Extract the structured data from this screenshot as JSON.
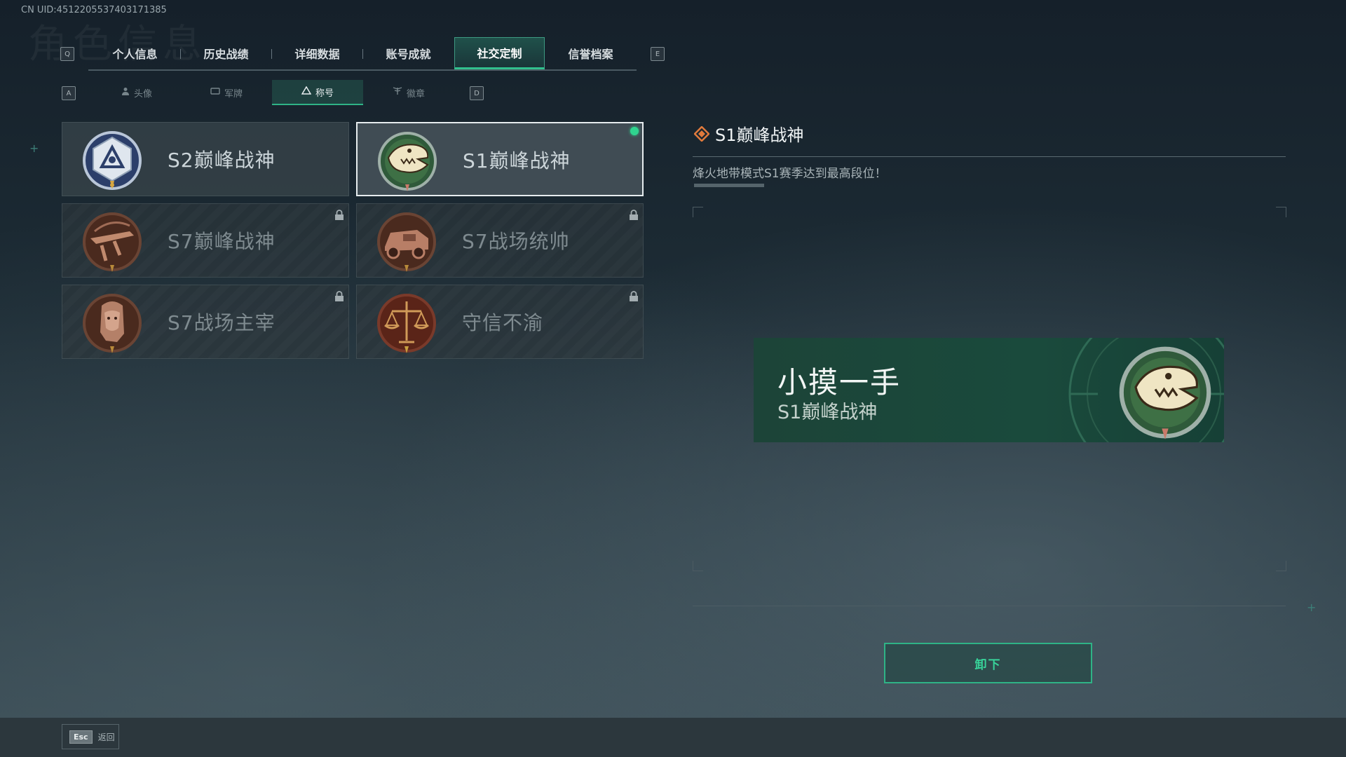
{
  "uid": "CN UID:4512205537403171385",
  "watermark": "角色信息",
  "main_tabs": {
    "left_key": "Q",
    "right_key": "E",
    "items": [
      "个人信息",
      "历史战绩",
      "详细数据",
      "账号成就",
      "社交定制",
      "信誉档案"
    ],
    "active_index": 4
  },
  "sub_tabs": {
    "left_key": "A",
    "right_key": "D",
    "items": [
      "头像",
      "军牌",
      "称号",
      "徽章"
    ],
    "active_index": 2
  },
  "titles": [
    {
      "label": "S2巅峰战神",
      "locked": false,
      "selected": false,
      "emblem": "silver-shield-emblem"
    },
    {
      "label": "S1巅峰战神",
      "locked": false,
      "selected": true,
      "emblem": "crocodile-emblem"
    },
    {
      "label": "S7巅峰战神",
      "locked": true,
      "selected": false,
      "emblem": "crossbow-emblem"
    },
    {
      "label": "S7战场统帅",
      "locked": true,
      "selected": false,
      "emblem": "armored-car-emblem"
    },
    {
      "label": "S7战场主宰",
      "locked": true,
      "selected": false,
      "emblem": "pharaoh-emblem"
    },
    {
      "label": "守信不渝",
      "locked": true,
      "selected": false,
      "emblem": "scales-emblem"
    }
  ],
  "detail": {
    "title": "S1巅峰战神",
    "description": "烽火地带模式S1赛季达到最高段位！"
  },
  "preview": {
    "player_name": "小摸一手",
    "title": "S1巅峰战神"
  },
  "unequip_label": "卸下",
  "footer": {
    "esc_key": "Esc",
    "back_label": "返回"
  },
  "colors": {
    "accent": "#2fb386",
    "equipped_dot": "#2fd48f",
    "banner_bg": "#1a4a3c"
  }
}
